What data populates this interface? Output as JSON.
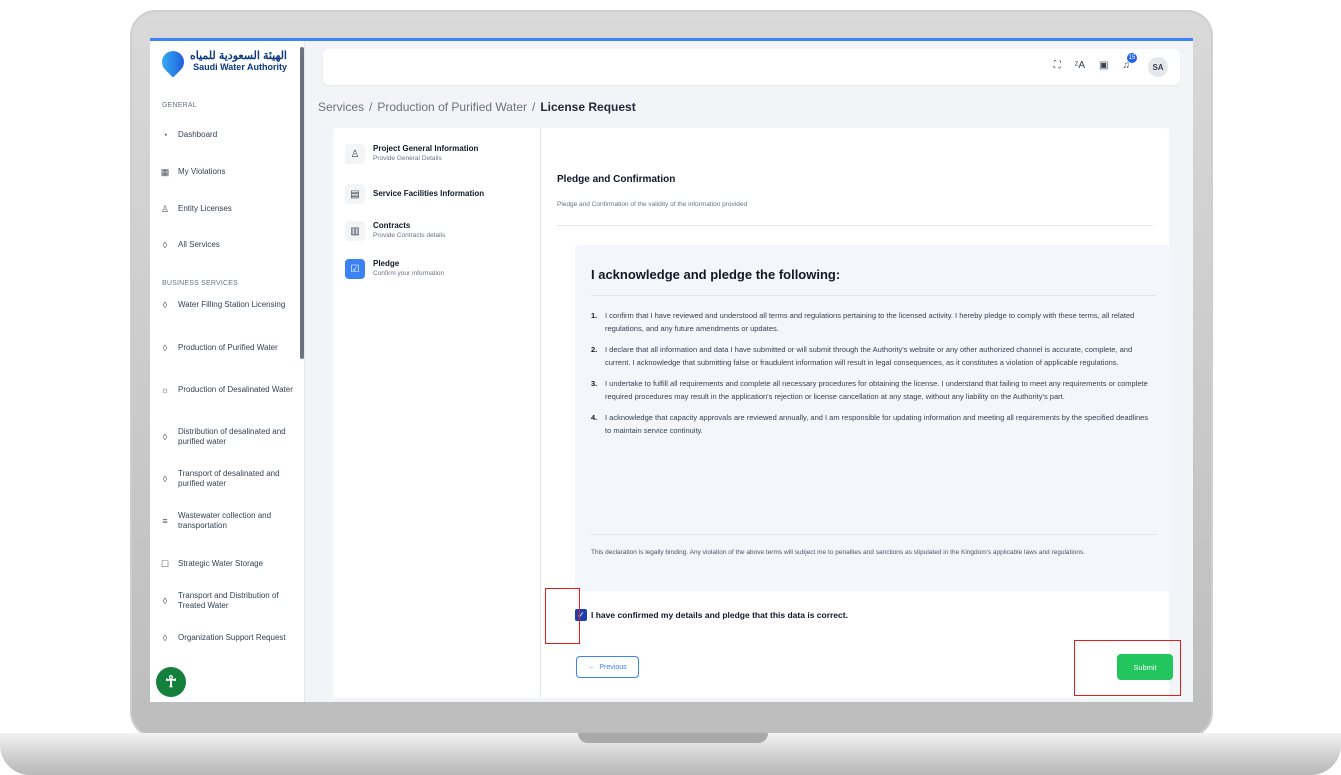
{
  "logo": {
    "arabic": "الهيئة السعودية للمياه",
    "english": "Saudi Water Authority"
  },
  "sidebar": {
    "general_label": "GENERAL",
    "general_items": [
      {
        "label": "Dashboard",
        "icon": "dashboard-icon"
      },
      {
        "label": "My Violations",
        "icon": "grid-icon"
      },
      {
        "label": "Entity Licenses",
        "icon": "user-icon"
      },
      {
        "label": "All Services",
        "icon": "drop-icon"
      }
    ],
    "business_label": "BUSINESS SERVICES",
    "business_items": [
      {
        "label": "Water Filling Station Licensing",
        "icon": "drop-icon"
      },
      {
        "label": "Production of Purified Water",
        "icon": "drop-icon"
      },
      {
        "label": "Production of Desalinated Water",
        "icon": "sun-icon"
      },
      {
        "label": "Distribution of desalinated and purified water",
        "icon": "drop-icon"
      },
      {
        "label": "Transport of desalinated and purified water",
        "icon": "drop-icon"
      },
      {
        "label": "Wastewater collection and transportation",
        "icon": "lines-icon"
      },
      {
        "label": "Strategic Water Storage",
        "icon": "storage-icon"
      },
      {
        "label": "Transport and Distribution of Treated Water",
        "icon": "drop-icon"
      },
      {
        "label": "Organization Support Request",
        "icon": "drop-icon"
      }
    ]
  },
  "topbar": {
    "notification_count": "15",
    "avatar_initials": "SA"
  },
  "breadcrumb": {
    "part1": "Services",
    "sep": "/",
    "part2": "Production of Purified Water",
    "current": "License Request"
  },
  "steps": [
    {
      "title": "Project General Information",
      "subtitle": "Provide General Details"
    },
    {
      "title": "Service Facilities Information",
      "subtitle": ""
    },
    {
      "title": "Contracts",
      "subtitle": "Provide Contracts details"
    },
    {
      "title": "Pledge",
      "subtitle": "Confirm your information"
    }
  ],
  "section": {
    "title": "Pledge and Confirmation",
    "subtitle": "Pledge and Confirmation of the validity of the information provided"
  },
  "pledge": {
    "heading": "I acknowledge and pledge the following:",
    "items": [
      {
        "num": "1.",
        "text": "I confirm that I have reviewed and understood all terms and regulations pertaining to the licensed activity. I hereby pledge to comply with these terms, all related regulations, and any future amendments or updates."
      },
      {
        "num": "2.",
        "text": "I declare that all information and data I have submitted or will submit through the Authority's website or any other authorized channel is accurate, complete, and current. I acknowledge that submitting false or fraudulent information will result in legal consequences, as it constitutes a violation of applicable regulations."
      },
      {
        "num": "3.",
        "text": "I undertake to fulfill all requirements and complete all necessary procedures for obtaining the license. I understand that failing to meet any requirements or complete required procedures may result in the application's rejection or license cancellation at any stage, without any liability on the Authority's part."
      },
      {
        "num": "4.",
        "text": "I acknowledge that capacity approvals are reviewed annually, and I am responsible for updating information and meeting all requirements by the specified deadlines to maintain service continuity."
      }
    ],
    "note": "This declaration is legally binding. Any violation of the above terms will subject me to penalties and sanctions as stipulated in the Kingdom's applicable laws and regulations."
  },
  "confirm": {
    "label": "I have confirmed my details and pledge that this data is correct.",
    "checked": true
  },
  "buttons": {
    "previous": "Previous",
    "submit": "Submit"
  },
  "colors": {
    "accent": "#3b82f6",
    "submit": "#22c55e",
    "highlight": "#e11d1d"
  }
}
